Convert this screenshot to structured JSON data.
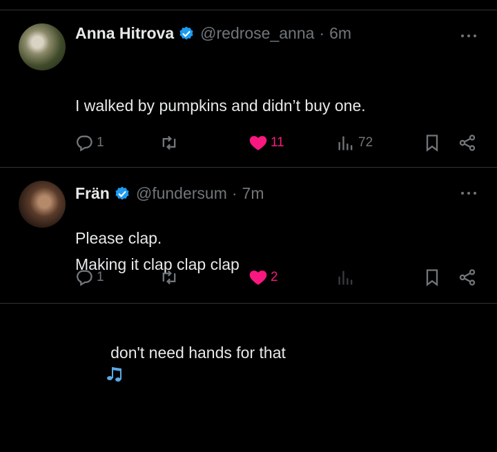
{
  "tweets": [
    {
      "name": "Anna Hitrova",
      "handle": "@redrose_anna",
      "separator": "·",
      "time": "6m",
      "lines": [
        "I walked by pumpkins and didn’t buy one.",
        "",
        "Please clap."
      ],
      "replies": "1",
      "likes": "11",
      "views": "72",
      "liked": true
    },
    {
      "name": "Frän",
      "handle": "@fundersum",
      "separator": "·",
      "time": "7m",
      "lines": [
        "Making it clap clap clap",
        "  don't need hands for that"
      ],
      "emoji": "music-notes-icon",
      "replies": "1",
      "likes": "2",
      "liked": true
    }
  ],
  "colors": {
    "background": "#000000",
    "text": "#e7e9ea",
    "muted": "#71767b",
    "like": "#f91880",
    "verified": "#1d9bf0",
    "divider": "#2f3336"
  }
}
